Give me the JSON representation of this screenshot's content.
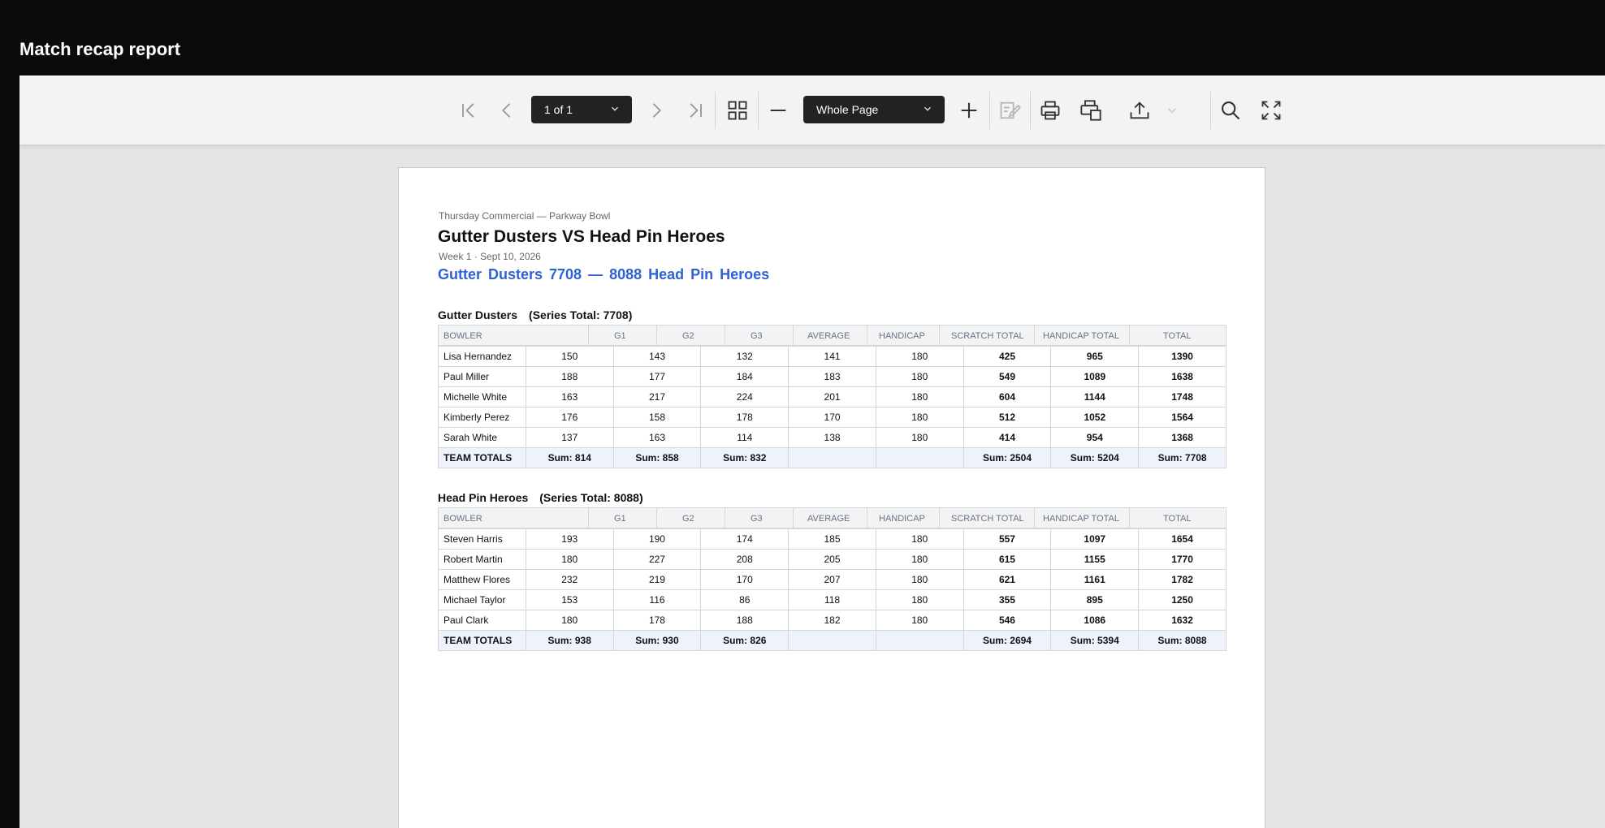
{
  "app_title": "Match recap report",
  "toolbar": {
    "page_select": "1 of 1",
    "zoom_select": "Whole Page"
  },
  "report": {
    "league": "Thursday Commercial — Parkway Bowl",
    "title": "Gutter Dusters VS Head Pin Heroes",
    "meta": "Week 1  ·  Sept 10, 2026",
    "score": "Gutter Dusters  7708  —  8088  Head Pin Heroes",
    "columns": [
      "BOWLER",
      "G1",
      "G2",
      "G3",
      "AVERAGE",
      "HANDICAP",
      "SCRATCH TOTAL",
      "HANDICAP TOTAL",
      "TOTAL"
    ],
    "teams": [
      {
        "name": "Gutter Dusters",
        "series": "(Series Total: 7708)",
        "rows": [
          [
            "Lisa Hernandez",
            "150",
            "143",
            "132",
            "141",
            "180",
            "425",
            "965",
            "1390"
          ],
          [
            "Paul Miller",
            "188",
            "177",
            "184",
            "183",
            "180",
            "549",
            "1089",
            "1638"
          ],
          [
            "Michelle White",
            "163",
            "217",
            "224",
            "201",
            "180",
            "604",
            "1144",
            "1748"
          ],
          [
            "Kimberly Perez",
            "176",
            "158",
            "178",
            "170",
            "180",
            "512",
            "1052",
            "1564"
          ],
          [
            "Sarah White",
            "137",
            "163",
            "114",
            "138",
            "180",
            "414",
            "954",
            "1368"
          ]
        ],
        "totals": [
          "TEAM TOTALS",
          "Sum: 814",
          "Sum: 858",
          "Sum: 832",
          "",
          "",
          "Sum: 2504",
          "Sum: 5204",
          "Sum: 7708"
        ]
      },
      {
        "name": "Head Pin Heroes",
        "series": "(Series Total: 8088)",
        "rows": [
          [
            "Steven Harris",
            "193",
            "190",
            "174",
            "185",
            "180",
            "557",
            "1097",
            "1654"
          ],
          [
            "Robert Martin",
            "180",
            "227",
            "208",
            "205",
            "180",
            "615",
            "1155",
            "1770"
          ],
          [
            "Matthew Flores",
            "232",
            "219",
            "170",
            "207",
            "180",
            "621",
            "1161",
            "1782"
          ],
          [
            "Michael Taylor",
            "153",
            "116",
            "86",
            "118",
            "180",
            "355",
            "895",
            "1250"
          ],
          [
            "Paul Clark",
            "180",
            "178",
            "188",
            "182",
            "180",
            "546",
            "1086",
            "1632"
          ]
        ],
        "totals": [
          "TEAM TOTALS",
          "Sum: 938",
          "Sum: 930",
          "Sum: 826",
          "",
          "",
          "Sum: 2694",
          "Sum: 5394",
          "Sum: 8088"
        ]
      }
    ]
  },
  "colors": {
    "accent": "#2f62d6",
    "totals_row_bg": "#eef2fb",
    "title_bar_bg": "#0b0b0d",
    "toolbar_bg": "#f3f3f3"
  }
}
